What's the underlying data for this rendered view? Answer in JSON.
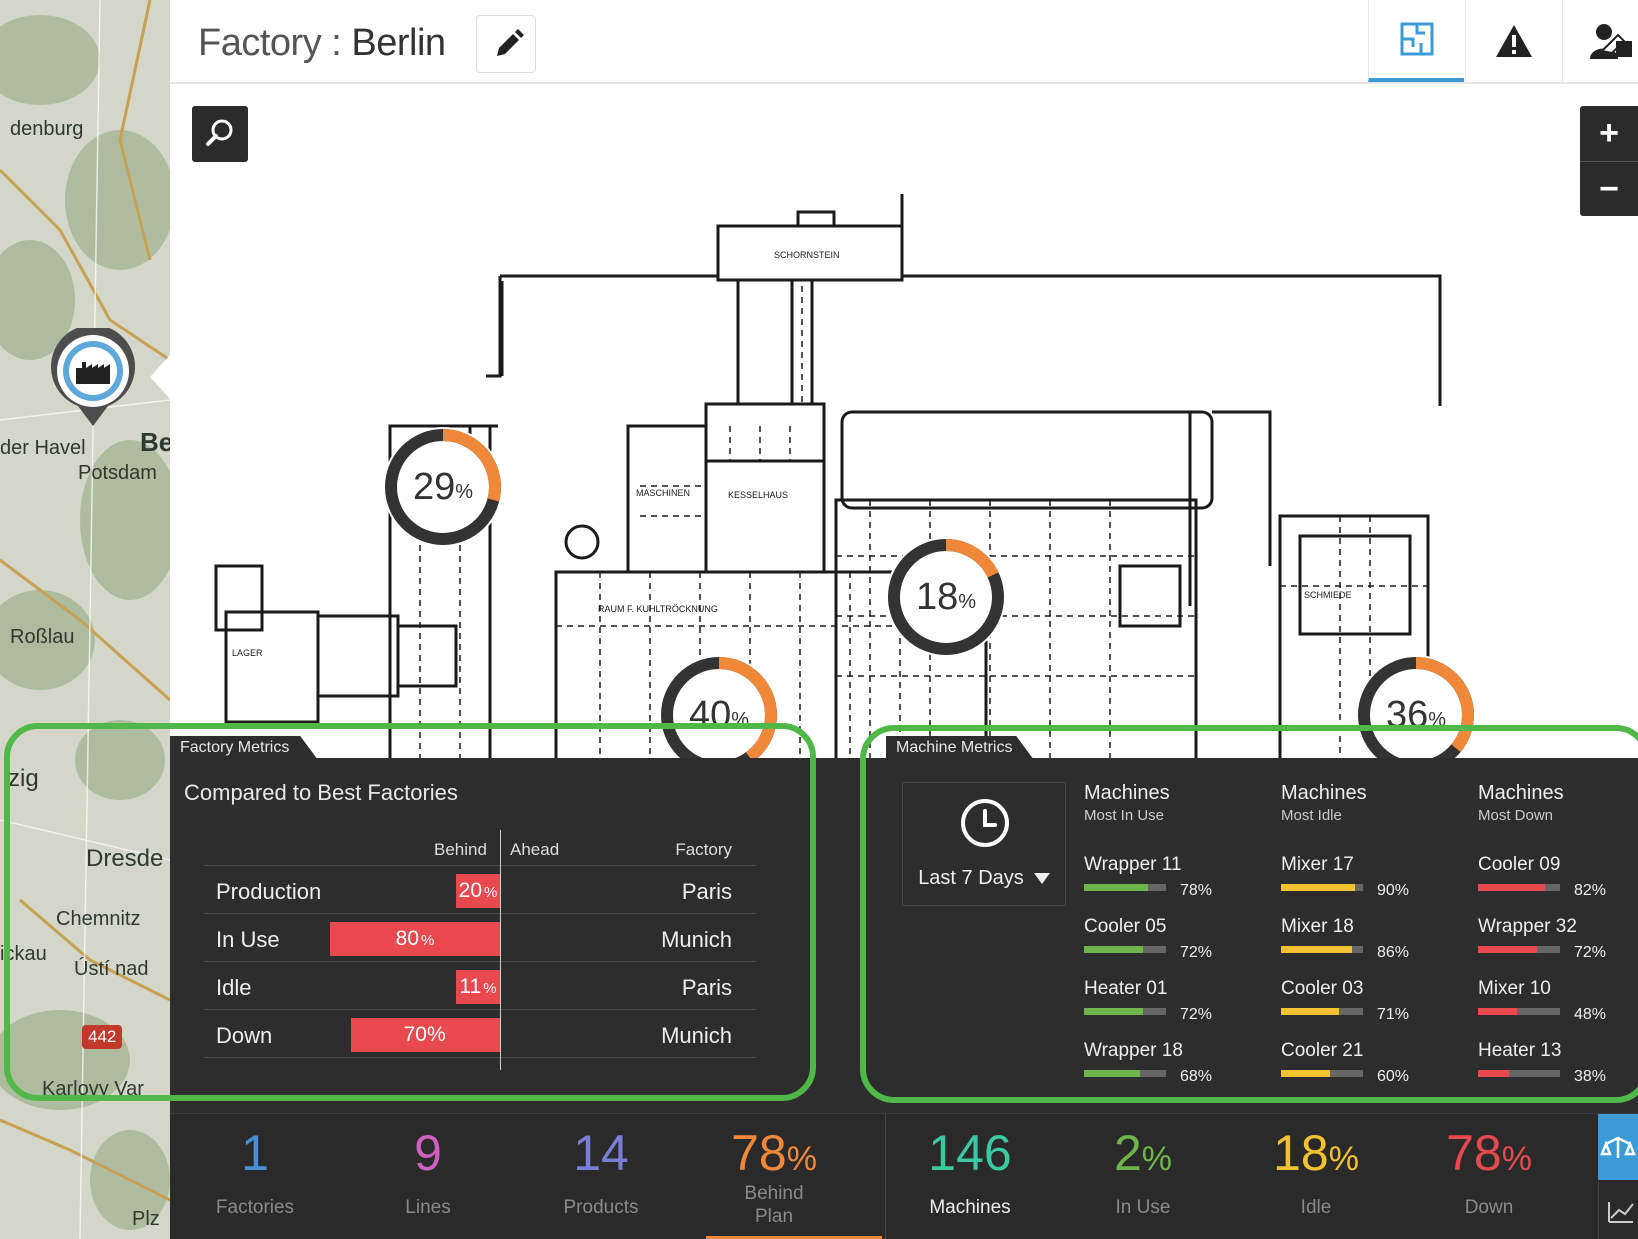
{
  "map": {
    "labels": [
      "denburg",
      "der Havel",
      "Be",
      "Potsdam",
      "Roßlau",
      "zig",
      "Dresde",
      "Chemnitz",
      "ickau",
      "Ústí nad",
      "Karlovy Var",
      "Plz",
      "442"
    ]
  },
  "header": {
    "title_prefix": "Factory :",
    "title_city": "Berlin"
  },
  "floorplan": {
    "gauges": [
      {
        "value": 29,
        "unit": "%"
      },
      {
        "value": 18,
        "unit": "%"
      },
      {
        "value": 40,
        "unit": "%"
      },
      {
        "value": 36,
        "unit": "%"
      }
    ]
  },
  "factory_metrics": {
    "tag": "Factory Metrics",
    "heading": "Compared to Best Factories",
    "col_behind": "Behind",
    "col_ahead": "Ahead",
    "col_factory": "Factory",
    "rows": [
      {
        "label": "Production",
        "value": "20",
        "unit": "%",
        "pct": 20,
        "factory": "Paris"
      },
      {
        "label": "In Use",
        "value": "80",
        "unit": "%",
        "pct": 80,
        "factory": "Munich"
      },
      {
        "label": "Idle",
        "value": "11",
        "unit": "%",
        "pct": 11,
        "factory": "Paris"
      },
      {
        "label": "Down",
        "value": "70%",
        "unit": "",
        "pct": 70,
        "factory": "Munich"
      }
    ]
  },
  "machine_metrics": {
    "tag": "Machine Metrics",
    "range_label": "Last 7 Days",
    "columns": [
      {
        "title": "Machines",
        "subtitle": "Most In Use",
        "color": "#6fb54b",
        "items": [
          {
            "name": "Wrapper 11",
            "pct": "78%",
            "fraction": 0.78
          },
          {
            "name": "Cooler 05",
            "pct": "72%",
            "fraction": 0.72
          },
          {
            "name": "Heater 01",
            "pct": "72%",
            "fraction": 0.72
          },
          {
            "name": "Wrapper 18",
            "pct": "68%",
            "fraction": 0.68
          }
        ]
      },
      {
        "title": "Machines",
        "subtitle": "Most Idle",
        "color": "#f2c230",
        "items": [
          {
            "name": "Mixer 17",
            "pct": "90%",
            "fraction": 0.9
          },
          {
            "name": "Mixer 18",
            "pct": "86%",
            "fraction": 0.86
          },
          {
            "name": "Cooler 03",
            "pct": "71%",
            "fraction": 0.71
          },
          {
            "name": "Cooler 21",
            "pct": "60%",
            "fraction": 0.6
          }
        ]
      },
      {
        "title": "Machines",
        "subtitle": "Most Down",
        "color": "#e8494e",
        "items": [
          {
            "name": "Cooler 09",
            "pct": "82%",
            "fraction": 0.82
          },
          {
            "name": "Wrapper 32",
            "pct": "72%",
            "fraction": 0.72
          },
          {
            "name": "Mixer 10",
            "pct": "48%",
            "fraction": 0.48
          },
          {
            "name": "Heater 13",
            "pct": "38%",
            "fraction": 0.38
          }
        ]
      }
    ]
  },
  "stats": [
    {
      "num": "1",
      "unit": "",
      "label": "Factories",
      "color": "#4a90d9"
    },
    {
      "num": "9",
      "unit": "",
      "label": "Lines",
      "color": "#d060c0"
    },
    {
      "num": "14",
      "unit": "",
      "label": "Products",
      "color": "#7a7fd6"
    },
    {
      "num": "78",
      "unit": "%",
      "label": "Behind Plan",
      "color": "#f0883a"
    },
    {
      "num": "146",
      "unit": "",
      "label": "Machines",
      "color": "#3cc8a0"
    },
    {
      "num": "2",
      "unit": "%",
      "label": "In Use",
      "color": "#6fb54b"
    },
    {
      "num": "18",
      "unit": "%",
      "label": "Idle",
      "color": "#f2c230"
    },
    {
      "num": "78",
      "unit": "%",
      "label": "Down",
      "color": "#e8494e"
    }
  ],
  "colors": {
    "accent": "#3b9bd8",
    "gauge_fill": "#f0883a",
    "gauge_track": "#333333",
    "bar_red": "#e8494e",
    "highlight": "#4fb848"
  },
  "icons": [
    "pencil-icon",
    "floorplan-icon",
    "warning-icon",
    "people-icon",
    "search-icon",
    "zoom-in-icon",
    "zoom-out-icon",
    "factory-icon",
    "clock-icon",
    "scale-icon",
    "trend-icon"
  ]
}
